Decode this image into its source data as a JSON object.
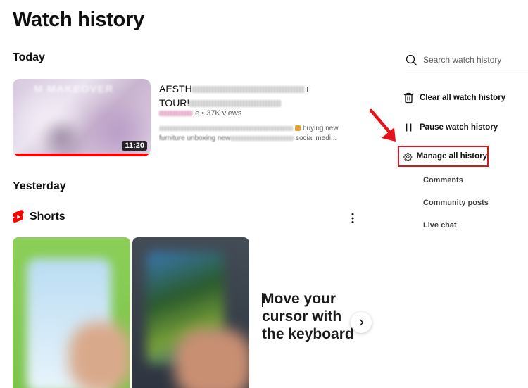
{
  "page": {
    "title": "Watch history"
  },
  "sections": {
    "today": "Today",
    "yesterday": "Yesterday"
  },
  "video": {
    "title_line1": "AESTH",
    "title_line1_end": "+",
    "title_line2": "TOUR!",
    "duration": "11:20",
    "thumb_word": "M MAKEOVER",
    "meta_views": "e • 37K views",
    "desc_line1_text": "buying new",
    "desc_line2_start": "furniture unboxing new",
    "desc_line2_end": "social medi..."
  },
  "shorts": {
    "label": "Shorts",
    "overlay_line1": "Move your",
    "overlay_line2": "cursor with",
    "overlay_line3": "the keyboard"
  },
  "sidebar": {
    "search_placeholder": "Search watch history",
    "clear_label": "Clear all watch history",
    "pause_label": "Pause watch history",
    "manage_label": "Manage all history",
    "comments_label": "Comments",
    "community_label": "Community posts",
    "livechat_label": "Live chat"
  },
  "icons": {
    "search": "search-icon",
    "trash": "trash-icon",
    "pause": "pause-icon",
    "gear": "gear-icon",
    "shorts": "shorts-logo-icon",
    "more": "more-vert-icon",
    "chevron": "chevron-right-icon",
    "arrow": "red-arrow-annotation"
  },
  "colors": {
    "brand_red": "#ff0000",
    "annotation_red": "#d4181f",
    "text_primary": "#0f0f0f",
    "text_secondary": "#606060"
  }
}
